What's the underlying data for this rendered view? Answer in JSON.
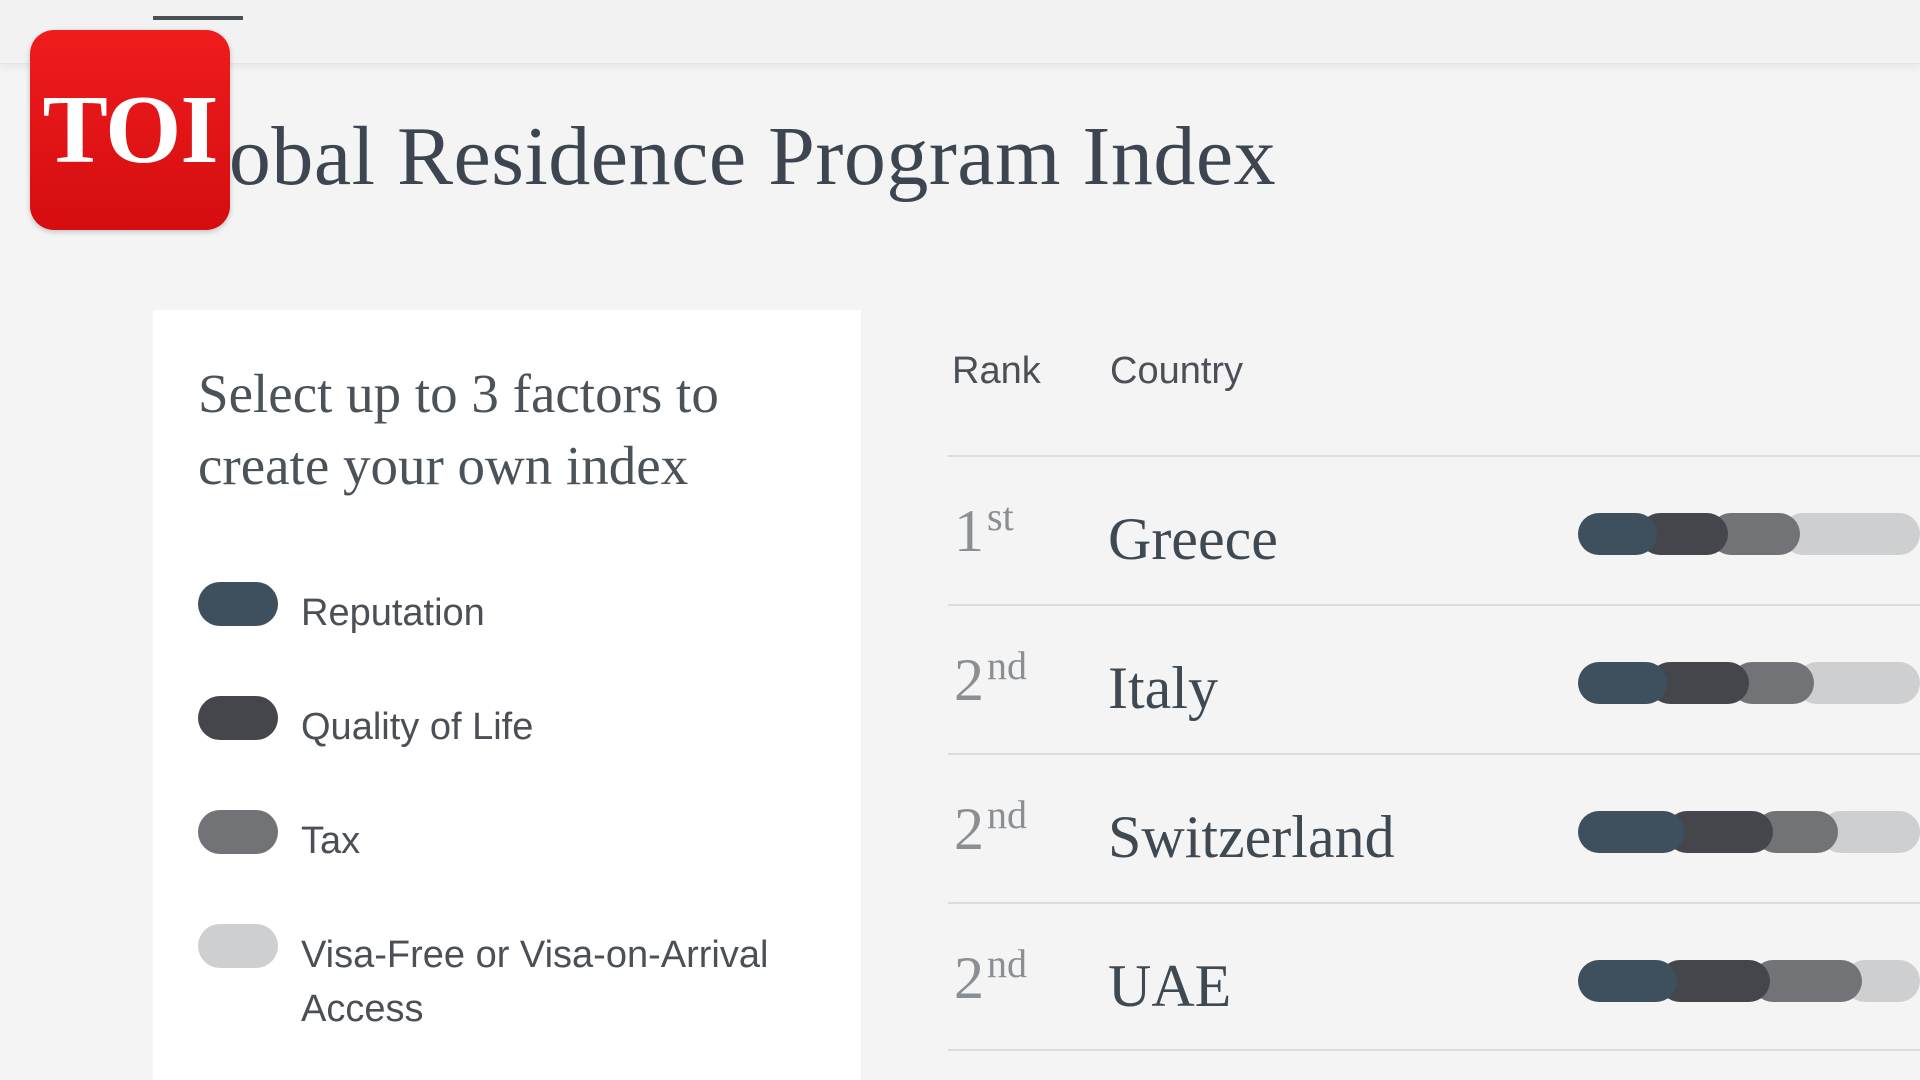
{
  "header": {
    "title": "lobal Residence Program Index"
  },
  "logo": {
    "text": "TOI",
    "color": "#e3141a"
  },
  "factors": {
    "prompt": "Select up to 3 factors to create your own index",
    "items": [
      {
        "label": "Reputation",
        "color": "#3e4f5e",
        "icon": "reputation-pill-icon"
      },
      {
        "label": "Quality of Life",
        "color": "#45464b",
        "icon": "quality-of-life-pill-icon"
      },
      {
        "label": "Tax",
        "color": "#727377",
        "icon": "tax-pill-icon"
      },
      {
        "label": "Visa-Free or Visa-on-Arrival Access",
        "color": "#cdcfd1",
        "icon": "visa-access-pill-icon"
      }
    ]
  },
  "table": {
    "columns": {
      "rank": "Rank",
      "country": "Country"
    },
    "rows": [
      {
        "rank_num": "1",
        "rank_suffix": "st",
        "country": "Greece",
        "segments": [
          0.23,
          0.21,
          0.21,
          0.35
        ]
      },
      {
        "rank_num": "2",
        "rank_suffix": "nd",
        "country": "Italy",
        "segments": [
          0.26,
          0.24,
          0.19,
          0.31
        ]
      },
      {
        "rank_num": "2",
        "rank_suffix": "nd",
        "country": "Switzerland",
        "segments": [
          0.31,
          0.26,
          0.19,
          0.24
        ]
      },
      {
        "rank_num": "2",
        "rank_suffix": "nd",
        "country": "UAE",
        "segments": [
          0.29,
          0.27,
          0.27,
          0.17
        ]
      }
    ]
  }
}
